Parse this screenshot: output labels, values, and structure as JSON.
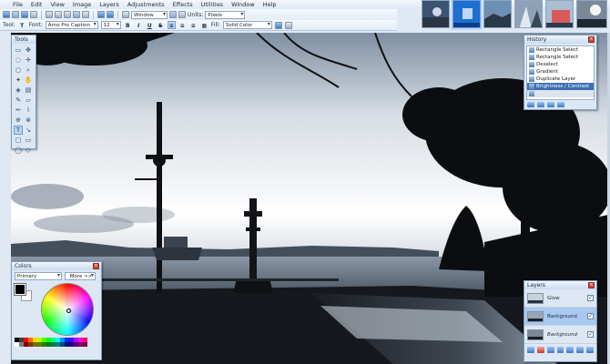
{
  "menu": [
    "File",
    "Edit",
    "View",
    "Image",
    "Layers",
    "Adjustments",
    "Effects",
    "Utilities",
    "Window",
    "Help"
  ],
  "toolbar1": {
    "zoom_value": "Window",
    "units_label": "Units:",
    "units_value": "Pixels"
  },
  "toolbar2": {
    "tool_label": "Tool:",
    "font_label": "Font:",
    "font_value": "Arno Pro Caption",
    "font_size": "12",
    "bold": "B",
    "italic": "I",
    "underline": "U",
    "fill_label": "Fill:",
    "fill_value": "Solid Color"
  },
  "tools_panel": {
    "title": "Tools"
  },
  "history_panel": {
    "title": "History",
    "items": [
      "Rectangle Select",
      "Rectangle Select",
      "Deselect",
      "Gradient",
      "Duplicate Layer",
      "Brightness / Contrast"
    ],
    "selected_index": 5
  },
  "colors_panel": {
    "title": "Colors",
    "mode": "Primary",
    "more_label": "More >>",
    "primary_color": "#000000",
    "secondary_color": "#ffffff"
  },
  "layers_panel": {
    "title": "Layers",
    "layers": [
      {
        "name": "Glow",
        "visible": true
      },
      {
        "name": "Background",
        "visible": true
      },
      {
        "name": "Background",
        "visible": true
      }
    ],
    "selected_index": 1
  },
  "accent_color": "#3d6fb0"
}
